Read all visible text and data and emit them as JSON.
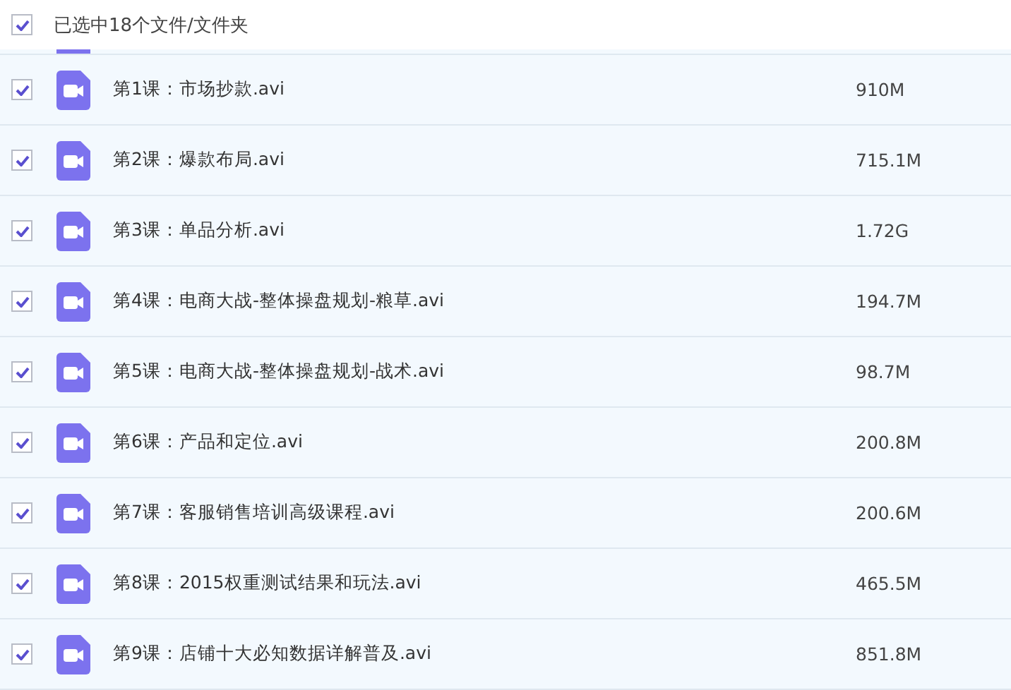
{
  "header": {
    "checked": true,
    "label": "已选中18个文件/文件夹"
  },
  "files": [
    {
      "name": "第1课：市场抄款.avi",
      "size": "910M",
      "checked": true
    },
    {
      "name": "第2课：爆款布局.avi",
      "size": "715.1M",
      "checked": true
    },
    {
      "name": "第3课：单品分析.avi",
      "size": "1.72G",
      "checked": true
    },
    {
      "name": "第4课：电商大战-整体操盘规划-粮草.avi",
      "size": "194.7M",
      "checked": true
    },
    {
      "name": "第5课：电商大战-整体操盘规划-战术.avi",
      "size": "98.7M",
      "checked": true
    },
    {
      "name": "第6课：产品和定位.avi",
      "size": "200.8M",
      "checked": true
    },
    {
      "name": "第7课：客服销售培训高级课程.avi",
      "size": "200.6M",
      "checked": true
    },
    {
      "name": "第8课：2015权重测试结果和玩法.avi",
      "size": "465.5M",
      "checked": true
    },
    {
      "name": "第9课：店铺十大必知数据详解普及.avi",
      "size": "851.8M",
      "checked": true
    }
  ]
}
